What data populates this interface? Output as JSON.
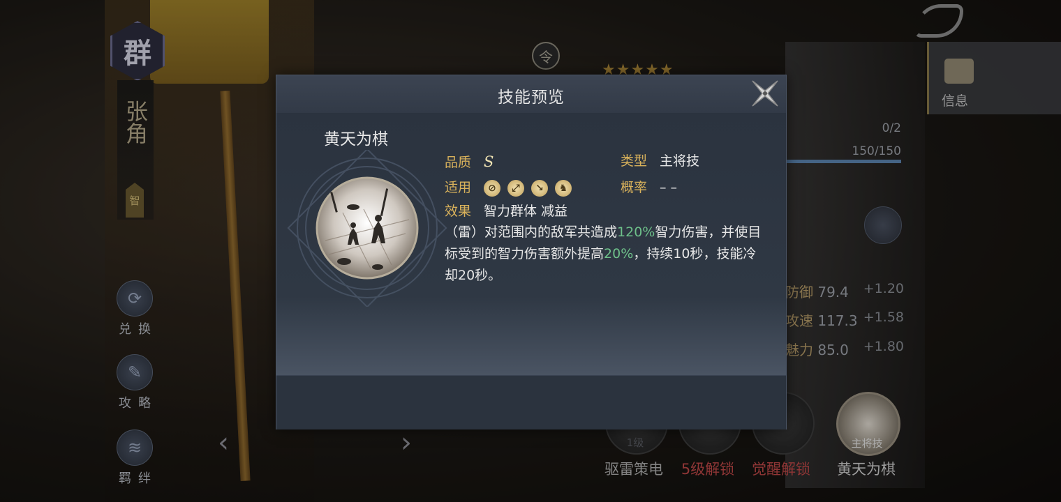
{
  "hero": {
    "faction": "群",
    "name": "张角",
    "type": "智"
  },
  "side_menu": [
    {
      "label": "兑换",
      "icon": "exchange-icon"
    },
    {
      "label": "攻略",
      "icon": "scroll-icon"
    },
    {
      "label": "羁绊",
      "icon": "bond-icon"
    }
  ],
  "nav": {
    "prev": "‹",
    "next": "›"
  },
  "ling_badge": "令",
  "stars": "★★★★★",
  "info_tab": {
    "label": "信息",
    "icon": "scroll-info-icon"
  },
  "right_stats": {
    "count": "0/2",
    "hp": "150/150",
    "hp_fraction": 1.0,
    "stats": [
      {
        "name": "防御",
        "value": "79.4",
        "inc": "+1.20"
      },
      {
        "name": "攻速",
        "value": "117.3",
        "inc": "+1.58"
      },
      {
        "name": "魅力",
        "value": "85.0",
        "inc": "+1.80"
      }
    ]
  },
  "skill_slots": [
    {
      "label": "驱雷策电",
      "badge": "1级",
      "color": "#b0b0b0"
    },
    {
      "label": "5级解锁",
      "badge": "",
      "color": "#c04848"
    },
    {
      "label": "觉醒解锁",
      "badge": "",
      "color": "#c04848"
    },
    {
      "label": "黄天为棋",
      "badge": "主将技",
      "color": "#d0d0d0"
    }
  ],
  "modal": {
    "title": "技能预览",
    "skill_name": "黄天为棋",
    "quality_label": "品质",
    "quality_value": "S",
    "type_label": "类型",
    "type_value": "主将技",
    "applicable_label": "适用",
    "applicable_icons": [
      "shield-unit-icon",
      "bow-unit-icon",
      "spear-unit-icon",
      "cavalry-unit-icon"
    ],
    "probability_label": "概率",
    "probability_value": "– –",
    "effect_label": "效果",
    "effect_value": "智力群体 减益",
    "description": {
      "p1": "（雷）对范围内的敌军共造成",
      "v1": "120%",
      "p2": "智力伤害，并使目标受到的智力伤害额外提高",
      "v2": "20%",
      "p3": "，持续10秒，技能冷却20秒。"
    }
  }
}
